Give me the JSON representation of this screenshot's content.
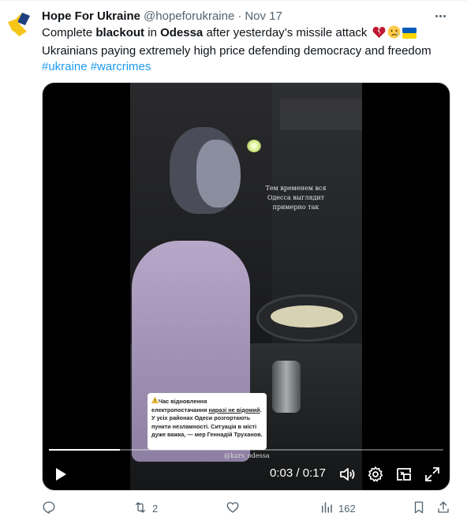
{
  "tweet": {
    "author_name": "Hope For Ukraine",
    "handle": "@hopeforukraine",
    "separator": "·",
    "date": "Nov 17",
    "text": {
      "p1": "Complete ",
      "b1": "blackout",
      "p2": " in ",
      "b2": "Odessa",
      "p3": " after yesterday’s missile attack ",
      "line2": "Ukrainians paying extremely high price defending democracy and freedom"
    },
    "emojis": [
      "broken-heart-icon",
      "crying-face-icon",
      "ukraine-flag-icon"
    ],
    "hashtags": [
      "#ukraine",
      "#warcrimes"
    ]
  },
  "video": {
    "overlay_ru": [
      "Тем временем вся",
      "Одесса выглядит",
      "примерно так"
    ],
    "overlay_ua": {
      "s1": "Час відновлення електропостачання ",
      "u1": "наразі не відомий",
      "s2": ". У усіх районах Одеси розгортають пункти незламності. Ситуація в місті дуже важка, — мер Геннадій Труханов."
    },
    "warning_emoji": "warning-icon",
    "watermark": "@kurs_odessa",
    "current_time": "0:03",
    "time_separator": " / ",
    "duration": "0:17",
    "progress": 0.18,
    "controls": [
      "play-icon",
      "volume-icon",
      "settings-icon",
      "pip-icon",
      "fullscreen-icon"
    ]
  },
  "actions": {
    "reply_count": "",
    "retweet_count": "2",
    "like_count": "",
    "views_count": "162"
  },
  "colors": {
    "link": "#1d9bf0",
    "muted": "#536471",
    "text": "#0f1419"
  }
}
